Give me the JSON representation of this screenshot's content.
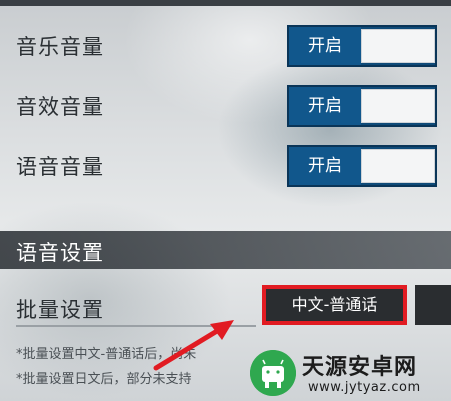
{
  "settings": [
    {
      "label": "音乐音量",
      "toggle_label": "开启"
    },
    {
      "label": "音效音量",
      "toggle_label": "开启"
    },
    {
      "label": "语音音量",
      "toggle_label": "开启"
    }
  ],
  "voice_section": {
    "title": "语音设置",
    "batch_label": "批量设置",
    "batch_value": "中文-普通话",
    "notes": [
      "*批量设置中文-普通话后，尚未",
      "*批量设置日文后，部分未支持"
    ]
  },
  "watermark": {
    "name": "天源安卓网",
    "url": "www.jytyaz.com"
  },
  "colors": {
    "toggle_blue": "#11578c",
    "highlight_red": "#e11b22",
    "watermark_green": "#2fa84f"
  }
}
